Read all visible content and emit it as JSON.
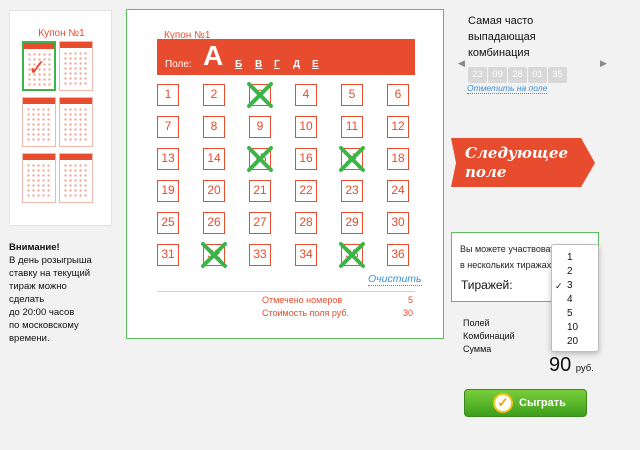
{
  "thumbnails": {
    "title": "Купон №1"
  },
  "notice": {
    "title": "Внимание!",
    "lines": [
      "В день розыгрыша",
      "ставку на текущий",
      "тираж можно",
      "сделать",
      "до 20:00 часов",
      "по московскому",
      "времени."
    ]
  },
  "coupon": {
    "title": "Купон №1",
    "field_label": "Поле:",
    "field_current": "А",
    "field_letters": [
      "Б",
      "В",
      "Г",
      "Д",
      "Е"
    ],
    "numbers": [
      1,
      2,
      3,
      4,
      5,
      6,
      7,
      8,
      9,
      10,
      11,
      12,
      13,
      14,
      15,
      16,
      17,
      18,
      19,
      20,
      21,
      22,
      23,
      24,
      25,
      26,
      27,
      28,
      29,
      30,
      31,
      32,
      33,
      34,
      35,
      36
    ],
    "crossed": [
      3,
      15,
      17,
      32,
      35
    ],
    "clear_label": "Очистить",
    "marked_label": "Отмечено номеров",
    "marked_value": "5",
    "cost_label": "Стоимость поля руб.",
    "cost_value": "30"
  },
  "frequent": {
    "title": "Самая часто выпадающая комбинация",
    "balls": [
      "23",
      "09",
      "28",
      "01",
      "35"
    ],
    "mark_link": "Отметить на поле",
    "prev_icon": "triangle-left",
    "next_icon": "triangle-right"
  },
  "next_field": {
    "label_line1": "Следующее",
    "label_line2": "поле"
  },
  "draws": {
    "text_line1": "Вы можете участвовать",
    "text_line2": "в нескольких тиражах",
    "label": "Тиражей:",
    "options": [
      "1",
      "2",
      "3",
      "4",
      "5",
      "10",
      "20"
    ],
    "selected": "3"
  },
  "summary": {
    "fields_label": "Полей",
    "combinations_label": "Комбинаций",
    "sum_label": "Сумма",
    "price": "90",
    "currency": "руб."
  },
  "play": {
    "label": "Сыграть"
  },
  "colors": {
    "accent": "#e84c2e",
    "green": "#3bb54a",
    "link": "#3a8fd6"
  }
}
